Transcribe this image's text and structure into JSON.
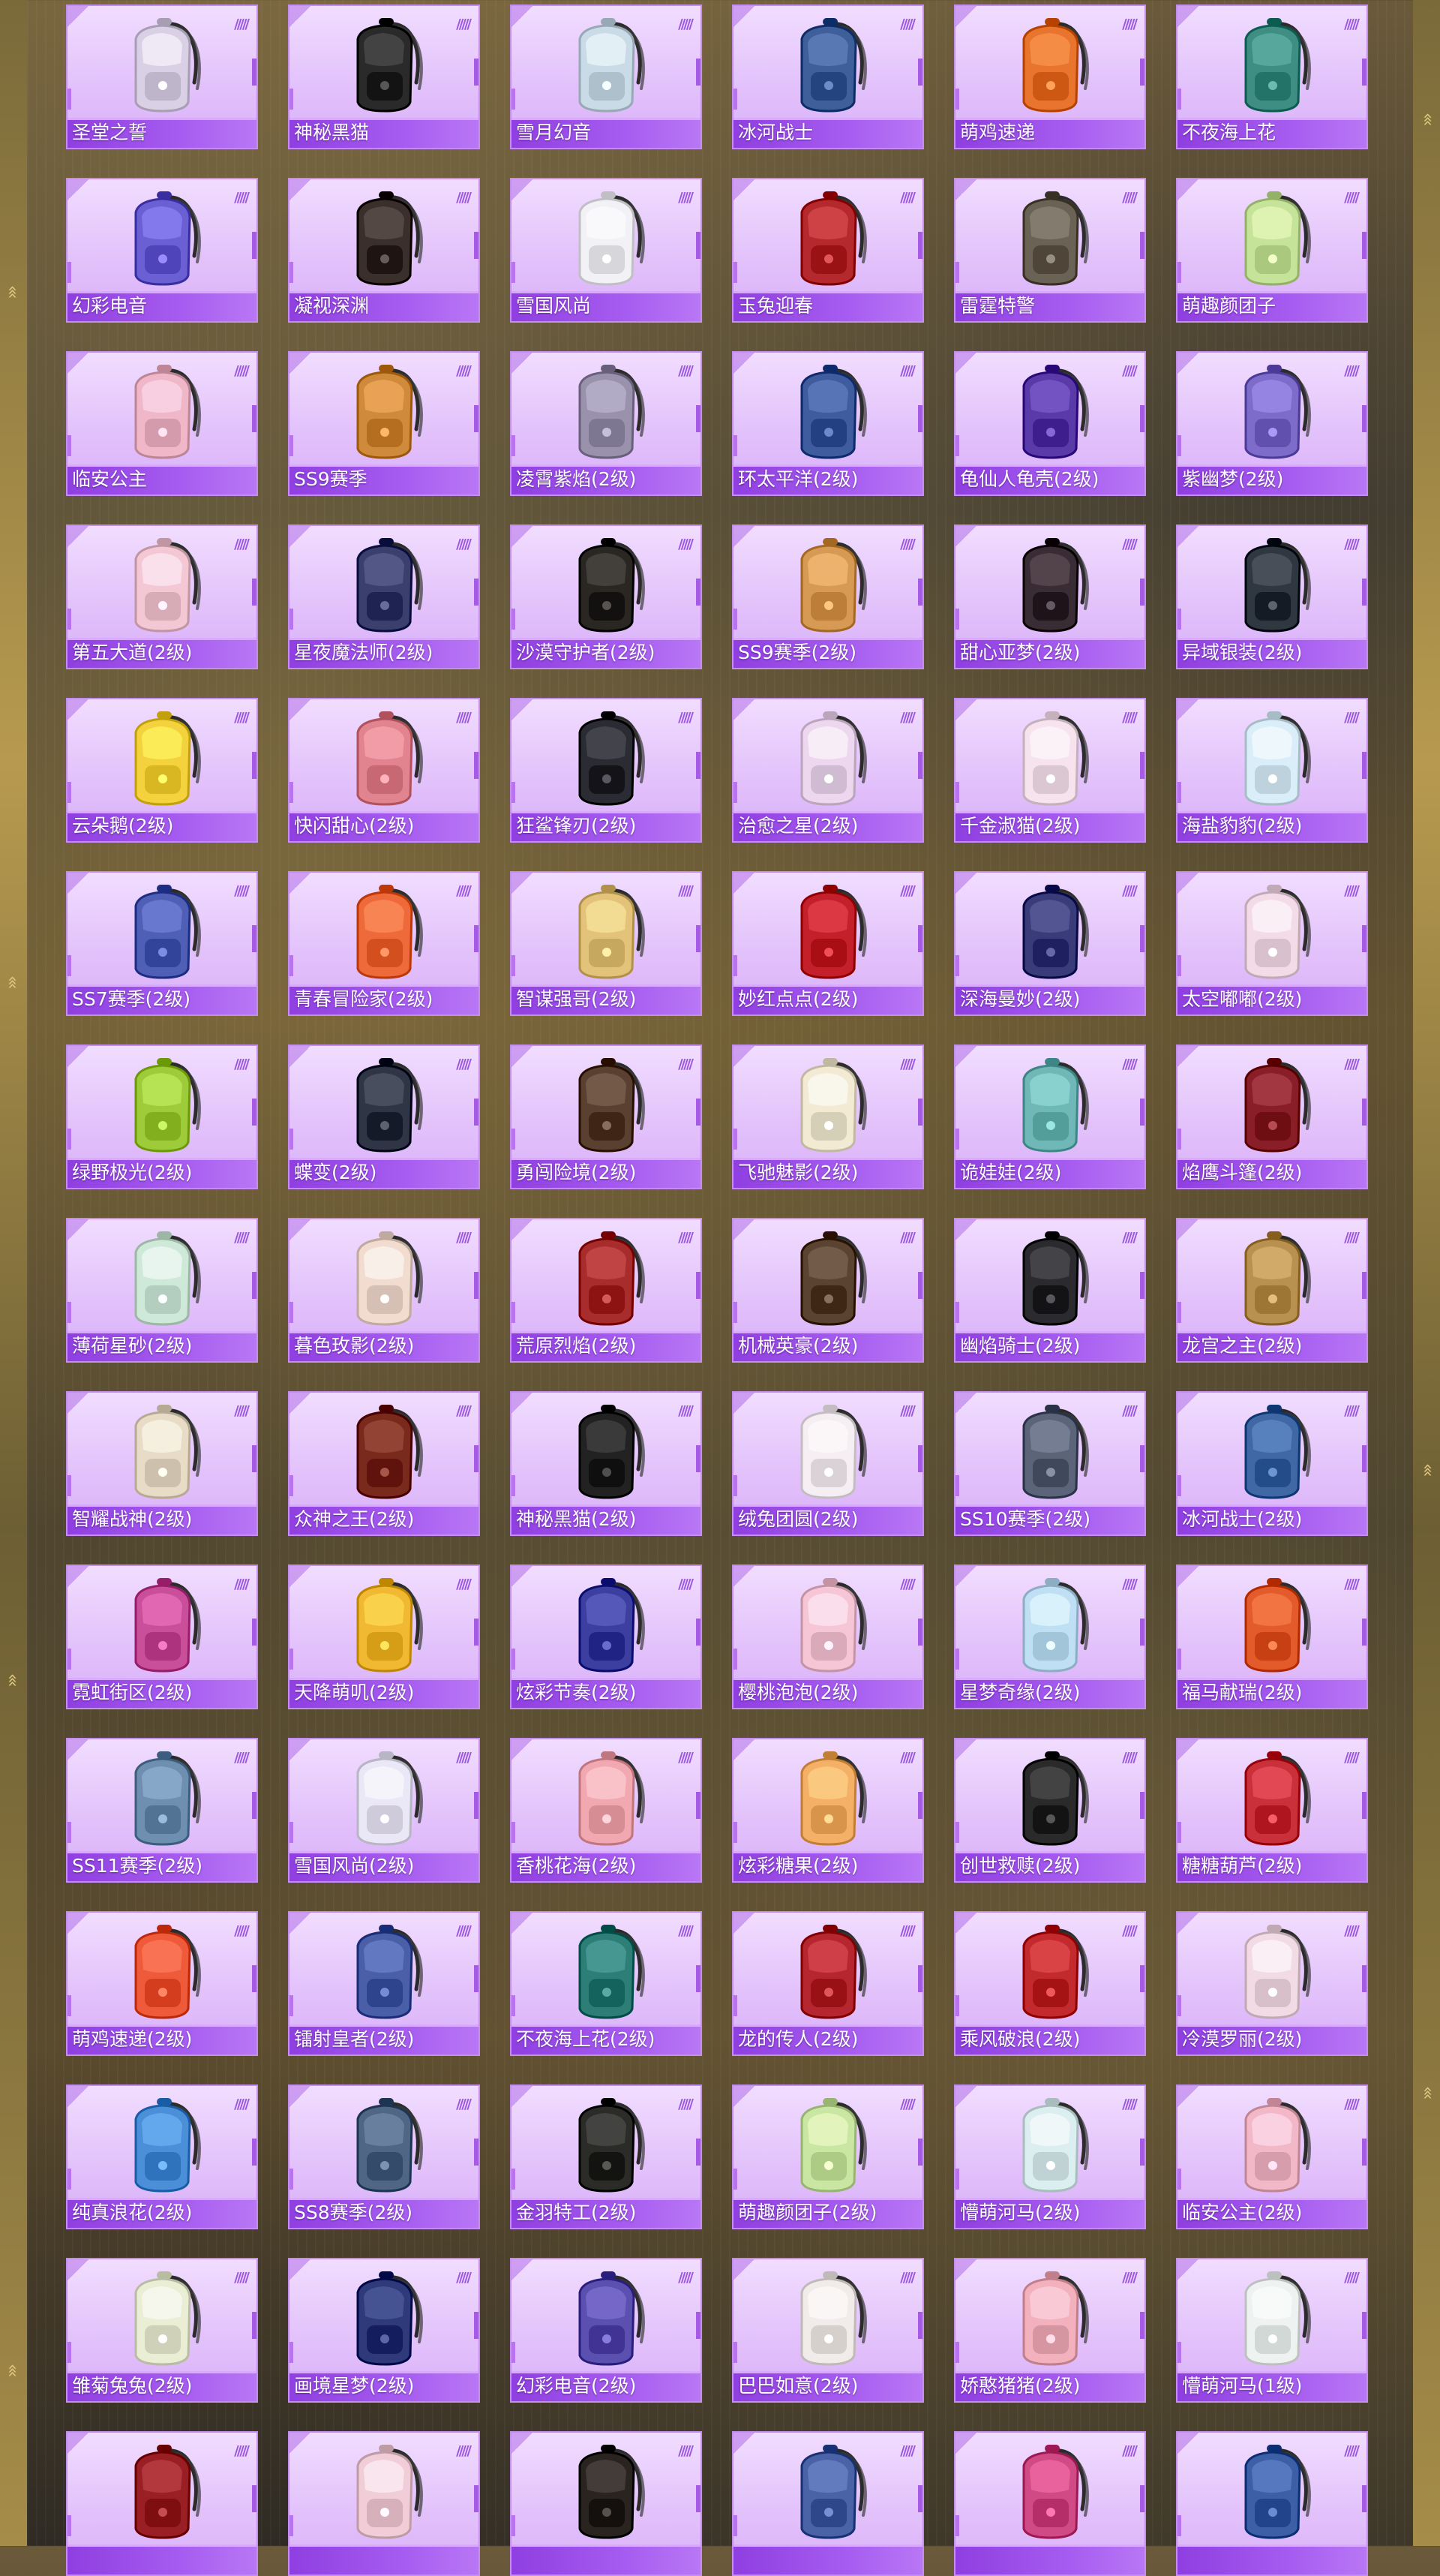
{
  "theme": {
    "card_bg": "#e6c8fb",
    "name_bar": "#9b4ce8",
    "accent": "#c58df0",
    "border_gold": "#b79a4f"
  },
  "decor": {
    "stripe_glyph": "/////",
    "chevron_glyph": "‹‹‹"
  },
  "items": [
    {
      "name": "圣堂之誓",
      "icon": "winged-crest-backpack-icon",
      "color": "#d9d0e6"
    },
    {
      "name": "神秘黑猫",
      "icon": "black-cat-backpack-icon",
      "color": "#2a2a2a"
    },
    {
      "name": "雪月幻音",
      "icon": "moon-orb-backpack-icon",
      "color": "#c9dbe6"
    },
    {
      "name": "冰河战士",
      "icon": "glacier-backpack-icon",
      "color": "#3e5f9a"
    },
    {
      "name": "萌鸡速递",
      "icon": "chick-backpack-icon",
      "color": "#e8742e"
    },
    {
      "name": "不夜海上花",
      "icon": "teal-flower-backpack-icon",
      "color": "#3e8e84"
    },
    {
      "name": "幻彩电音",
      "icon": "neon-disc-backpack-icon",
      "color": "#6b5fd4"
    },
    {
      "name": "凝视深渊",
      "icon": "abyss-backpack-icon",
      "color": "#3a2f2a"
    },
    {
      "name": "雪国风尚",
      "icon": "snowman-backpack-icon",
      "color": "#f1f1f6"
    },
    {
      "name": "玉兔迎春",
      "icon": "red-rabbit-backpack-icon",
      "color": "#b5282d"
    },
    {
      "name": "雷霆特警",
      "icon": "tactical-backpack-icon",
      "color": "#6a6254"
    },
    {
      "name": "萌趣颜团子",
      "icon": "sprout-buddy-backpack-icon",
      "color": "#c5e49a"
    },
    {
      "name": "临安公主",
      "icon": "pink-blossom-backpack-icon",
      "color": "#f0b7c8"
    },
    {
      "name": "SS9赛季",
      "icon": "capsule-backpack-icon",
      "color": "#d08a3c"
    },
    {
      "name": "凌霄紫焰(2级)",
      "icon": "silver-mask-backpack-icon",
      "color": "#9a92ad"
    },
    {
      "name": "环太平洋(2级)",
      "icon": "mecha-backpack-icon",
      "color": "#3e5c9e"
    },
    {
      "name": "龟仙人龟壳(2级)",
      "icon": "turtle-shell-backpack-icon",
      "color": "#5a3aa8"
    },
    {
      "name": "紫幽梦(2级)",
      "icon": "purple-orb-backpack-icon",
      "color": "#7d6cc9"
    },
    {
      "name": "第五大道(2级)",
      "icon": "pink-bag-backpack-icon",
      "color": "#f3c7d3"
    },
    {
      "name": "星夜魔法师(2级)",
      "icon": "wizard-backpack-icon",
      "color": "#3b3f6e"
    },
    {
      "name": "沙漠守护者(2级)",
      "icon": "anubis-backpack-icon",
      "color": "#2a2622"
    },
    {
      "name": "SS9赛季(2级)",
      "icon": "orange-capsule-backpack-icon",
      "color": "#d79a54"
    },
    {
      "name": "甜心亚梦(2级)",
      "icon": "dark-cat-backpack-icon",
      "color": "#3a2c34"
    },
    {
      "name": "异域银装(2级)",
      "icon": "camera-backpack-icon",
      "color": "#2f3740"
    },
    {
      "name": "云朵鹅(2级)",
      "icon": "yellow-goose-backpack-icon",
      "color": "#f4d23e"
    },
    {
      "name": "快闪甜心(2级)",
      "icon": "pink-robot-backpack-icon",
      "color": "#e2848f"
    },
    {
      "name": "狂鲨锋刃(2级)",
      "icon": "shark-backpack-icon",
      "color": "#2b2b33"
    },
    {
      "name": "治愈之星(2级)",
      "icon": "white-star-backpack-icon",
      "color": "#ecd7ee"
    },
    {
      "name": "千金淑猫(2级)",
      "icon": "white-cat-backpack-icon",
      "color": "#f6e3ee"
    },
    {
      "name": "海盐豹豹(2级)",
      "icon": "seal-backpack-icon",
      "color": "#d9eef8"
    },
    {
      "name": "SS7赛季(2级)",
      "icon": "blue-season-backpack-icon",
      "color": "#4e5fb5"
    },
    {
      "name": "青春冒险家(2级)",
      "icon": "orange-adventurer-backpack-icon",
      "color": "#ef6a3a"
    },
    {
      "name": "智谋强哥(2级)",
      "icon": "bunny-chick-backpack-icon",
      "color": "#e3c37a"
    },
    {
      "name": "妙红点点(2级)",
      "icon": "ladybug-backpack-icon",
      "color": "#c3202b"
    },
    {
      "name": "深海曼妙(2级)",
      "icon": "deepsea-backpack-icon",
      "color": "#3a3c7a"
    },
    {
      "name": "太空嘟嘟(2级)",
      "icon": "heart-radish-backpack-icon",
      "color": "#f3dbe8"
    },
    {
      "name": "绿野极光(2级)",
      "icon": "green-box-backpack-icon",
      "color": "#9ecb3a"
    },
    {
      "name": "蝶变(2级)",
      "icon": "butterfly-backpack-icon",
      "color": "#2f3545"
    },
    {
      "name": "勇闯险境(2级)",
      "icon": "barrel-backpack-icon",
      "color": "#5a4030"
    },
    {
      "name": "飞驰魅影(2级)",
      "icon": "white-racer-backpack-icon",
      "color": "#f2ead2"
    },
    {
      "name": "诡娃娃(2级)",
      "icon": "doll-backpack-icon",
      "color": "#6fb8b7"
    },
    {
      "name": "焰鹰斗篷(2级)",
      "icon": "red-eagle-backpack-icon",
      "color": "#8a1e28"
    },
    {
      "name": "薄荷星砂(2级)",
      "icon": "mint-backpack-icon",
      "color": "#cfe9d9"
    },
    {
      "name": "暮色玫影(2级)",
      "icon": "doll-girl-backpack-icon",
      "color": "#f2dcd0"
    },
    {
      "name": "荒原烈焰(2级)",
      "icon": "red-harness-backpack-icon",
      "color": "#a82c2c"
    },
    {
      "name": "机械英豪(2级)",
      "icon": "mech-hero-backpack-icon",
      "color": "#5a4330"
    },
    {
      "name": "幽焰骑士(2级)",
      "icon": "dark-knight-backpack-icon",
      "color": "#2b2b2f"
    },
    {
      "name": "龙宫之主(2级)",
      "icon": "dragon-palace-backpack-icon",
      "color": "#b89050"
    },
    {
      "name": "智耀战神(2级)",
      "icon": "shell-backpack-icon",
      "color": "#e9dcc7"
    },
    {
      "name": "众神之王(2级)",
      "icon": "god-king-backpack-icon",
      "color": "#7a2a1c"
    },
    {
      "name": "神秘黑猫(2级)",
      "icon": "black-cat-backpack-icon",
      "color": "#222222"
    },
    {
      "name": "绒兔团圆(2级)",
      "icon": "white-bunny-backpack-icon",
      "color": "#f5eef2"
    },
    {
      "name": "SS10赛季(2级)",
      "icon": "grey-season-backpack-icon",
      "color": "#5b6478"
    },
    {
      "name": "冰河战士(2级)",
      "icon": "glacier-backpack-icon",
      "color": "#3f68a5"
    },
    {
      "name": "霓虹街区(2级)",
      "icon": "neon-pink-backpack-icon",
      "color": "#c94f9a"
    },
    {
      "name": "天降萌叽(2级)",
      "icon": "yellow-chick-backpack-icon",
      "color": "#f1b832"
    },
    {
      "name": "炫彩节奏(2级)",
      "icon": "rhythm-backpack-icon",
      "color": "#3c3ea0"
    },
    {
      "name": "樱桃泡泡(2级)",
      "icon": "bow-backpack-icon",
      "color": "#f7c6d6"
    },
    {
      "name": "星梦奇缘(2级)",
      "icon": "swan-backpack-icon",
      "color": "#bfe0f4"
    },
    {
      "name": "福马献瑞(2级)",
      "icon": "fortune-horse-backpack-icon",
      "color": "#e35b2b"
    },
    {
      "name": "SS11赛季(2级)",
      "icon": "silver-season-backpack-icon",
      "color": "#6e8fb0"
    },
    {
      "name": "雪国风尚(2级)",
      "icon": "snowman-backpack-icon",
      "color": "#eae7f6"
    },
    {
      "name": "香桃花海(2级)",
      "icon": "peach-backpack-icon",
      "color": "#f2a8b0"
    },
    {
      "name": "炫彩糖果(2级)",
      "icon": "candy-backpack-icon",
      "color": "#f4b066"
    },
    {
      "name": "创世救赎(2级)",
      "icon": "gold-emblem-backpack-icon",
      "color": "#2a2a2a"
    },
    {
      "name": "糖糖葫芦(2级)",
      "icon": "candied-haw-backpack-icon",
      "color": "#c9303a"
    },
    {
      "name": "萌鸡速递(2级)",
      "icon": "chick-backpack-icon",
      "color": "#ef5a3a"
    },
    {
      "name": "镭射皇者(2级)",
      "icon": "laser-king-backpack-icon",
      "color": "#4a5fa8"
    },
    {
      "name": "不夜海上花(2级)",
      "icon": "teal-flower-backpack-icon",
      "color": "#2e7e78"
    },
    {
      "name": "龙的传人(2级)",
      "icon": "dragon-heir-backpack-icon",
      "color": "#b5262f"
    },
    {
      "name": "乘风破浪(2级)",
      "icon": "red-crystal-backpack-icon",
      "color": "#c22a2e"
    },
    {
      "name": "冷漠罗丽(2级)",
      "icon": "lolita-backpack-icon",
      "color": "#f3dbe6"
    },
    {
      "name": "纯真浪花(2级)",
      "icon": "ice-cream-backpack-icon",
      "color": "#4b8fd8"
    },
    {
      "name": "SS8赛季(2级)",
      "icon": "grey-blue-backpack-icon",
      "color": "#506685"
    },
    {
      "name": "金羽特工(2级)",
      "icon": "black-agent-backpack-icon",
      "color": "#2b2b28"
    },
    {
      "name": "萌趣颜团子(2级)",
      "icon": "sprout-buddy-backpack-icon",
      "color": "#c9e7a2"
    },
    {
      "name": "懵萌河马(2级)",
      "icon": "hippo-backpack-icon",
      "color": "#dbeef0"
    },
    {
      "name": "临安公主(2级)",
      "icon": "pink-blossom-backpack-icon",
      "color": "#f2b8c8"
    },
    {
      "name": "雏菊兔兔(2级)",
      "icon": "daisy-bunny-backpack-icon",
      "color": "#eaeed5"
    },
    {
      "name": "画境星梦(2级)",
      "icon": "painting-backpack-icon",
      "color": "#2e3a7a"
    },
    {
      "name": "幻彩电音(2级)",
      "icon": "alien-backpack-icon",
      "color": "#5b4fb0"
    },
    {
      "name": "巴巴如意(2级)",
      "icon": "white-bunny-backpack-icon",
      "color": "#f1ece9"
    },
    {
      "name": "娇憨猪猪(2级)",
      "icon": "pig-backpack-icon",
      "color": "#f2b1bd"
    },
    {
      "name": "懵萌河马(1级)",
      "icon": "hippo-backpack-icon",
      "color": "#eef3f2"
    }
  ],
  "partial_row": [
    {
      "icon": "red-black-backpack-icon",
      "color": "#9a1f25"
    },
    {
      "icon": "pink-bag-backpack-icon",
      "color": "#f1cdd8"
    },
    {
      "icon": "orange-black-backpack-icon",
      "color": "#2a2420"
    },
    {
      "icon": "laser-king-backpack-icon",
      "color": "#4963a6"
    },
    {
      "icon": "pink-sport-backpack-icon",
      "color": "#d04a86"
    },
    {
      "icon": "blue-white-backpack-icon",
      "color": "#3d5fa6"
    }
  ]
}
